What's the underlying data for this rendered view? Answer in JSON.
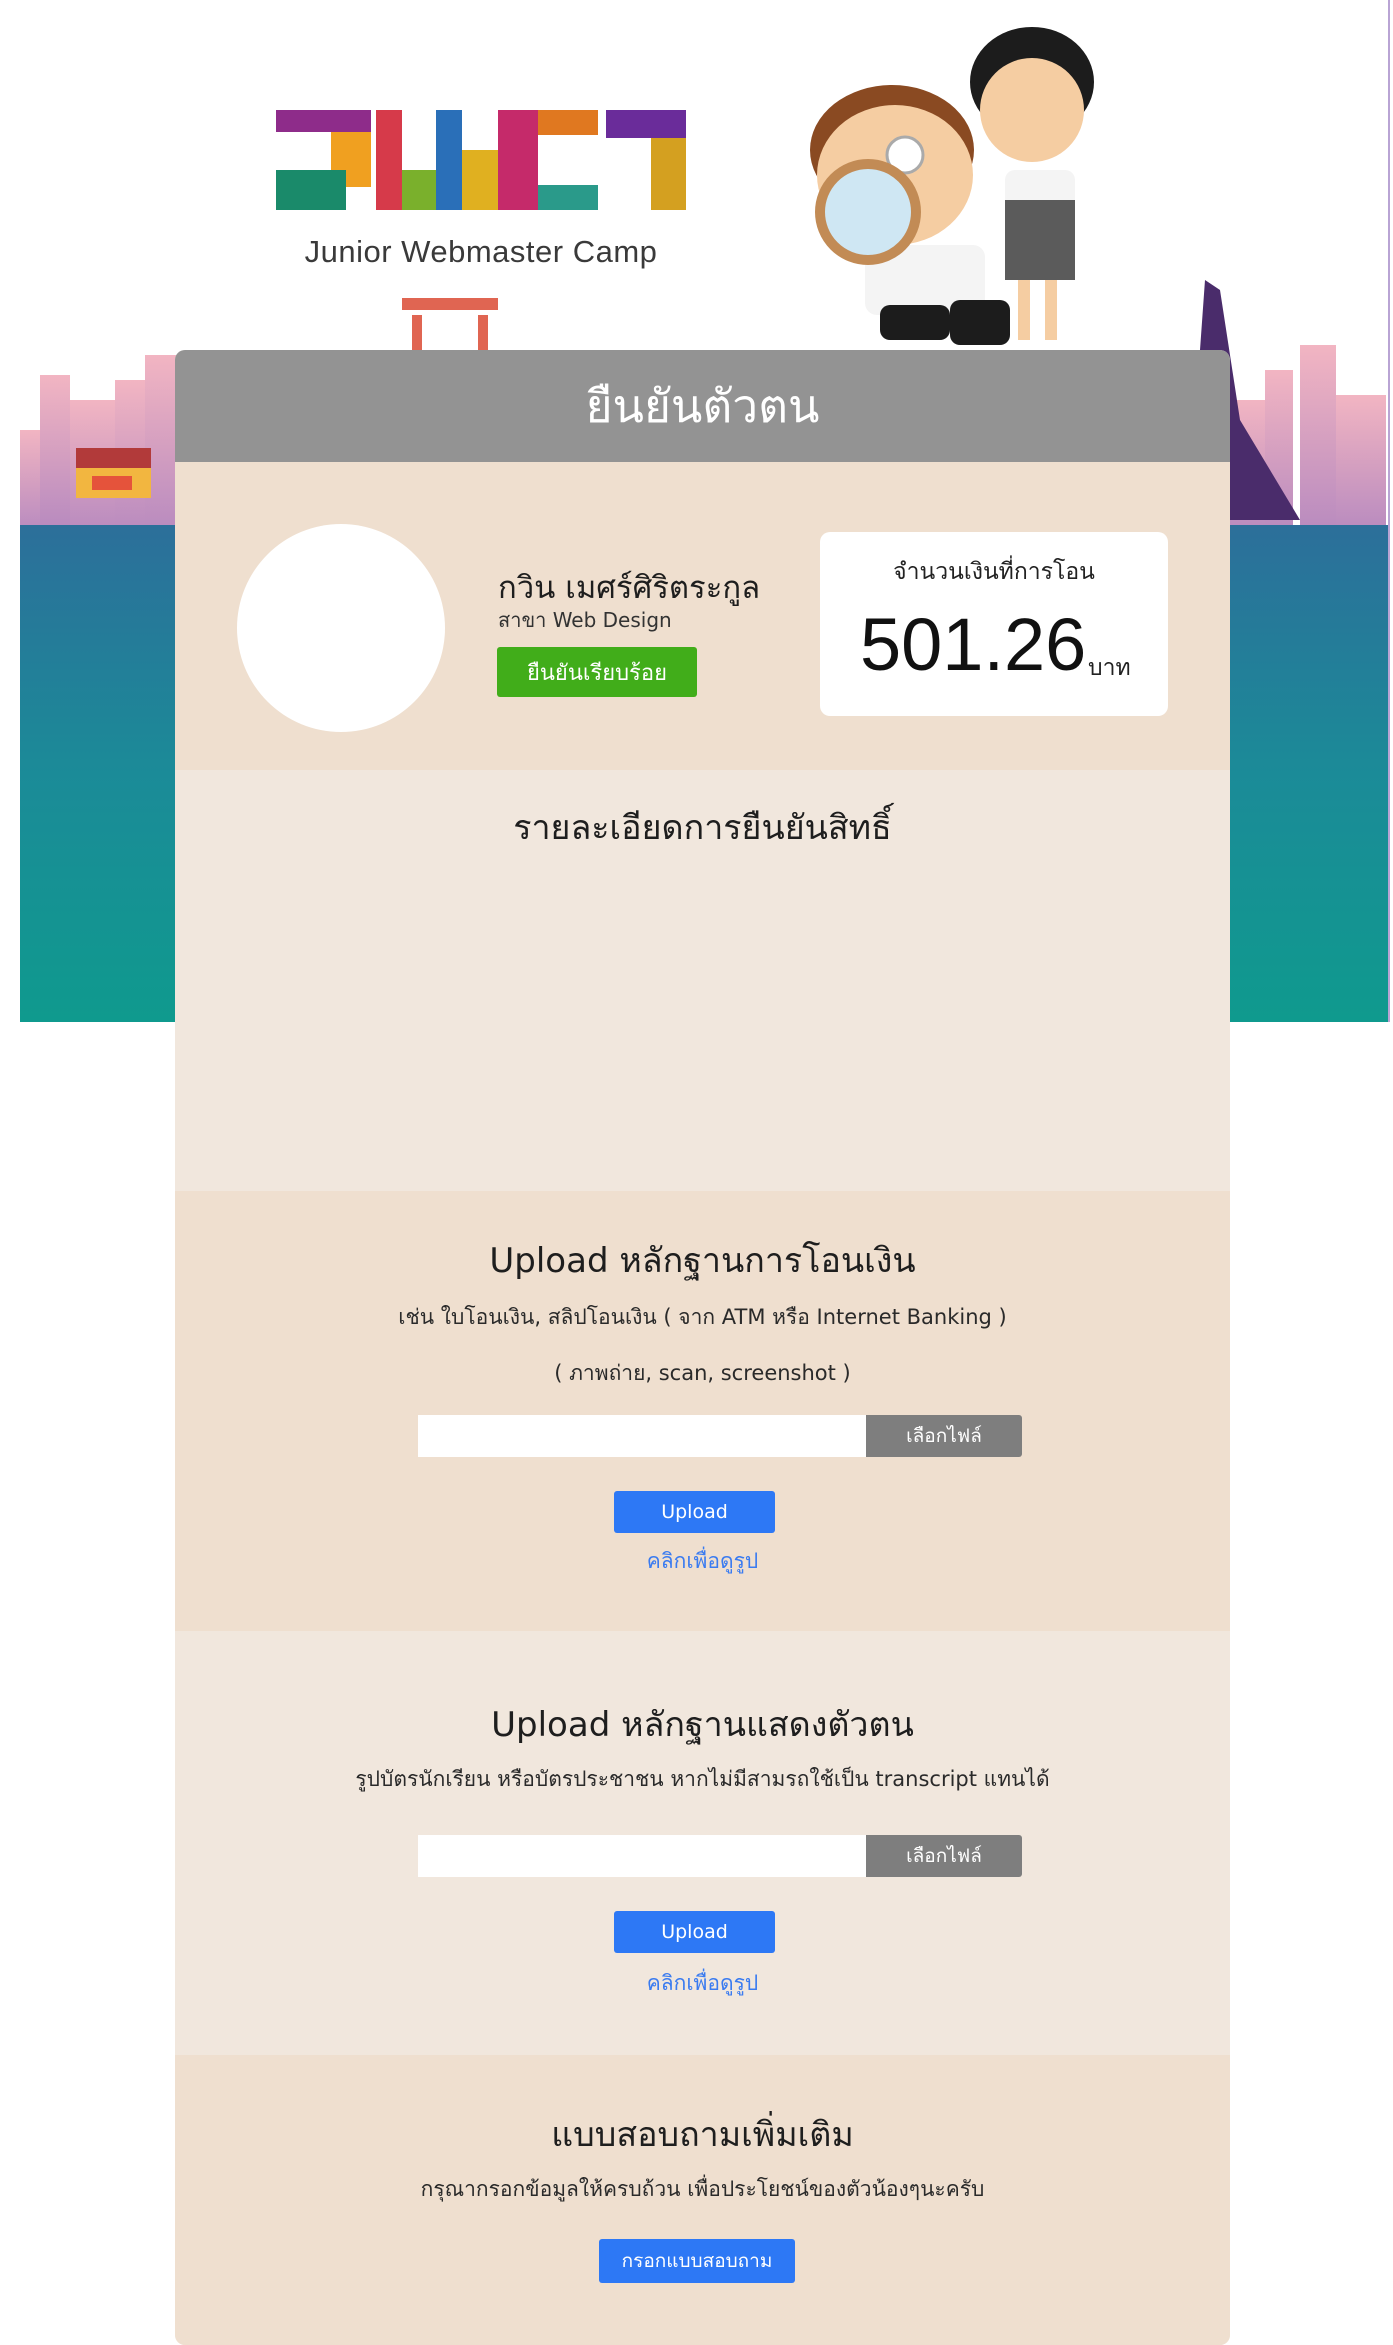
{
  "brand": {
    "logo_text": "JWC7",
    "subtitle": "Junior Webmaster Camp"
  },
  "card": {
    "title": "ยืนยันตัวตน"
  },
  "profile": {
    "name": "กวิน เมศร์ศิริตระกูล",
    "major": "สาขา Web Design",
    "status_button": "ยืนยันเรียบร้อย",
    "amount_label": "จำนวนเงินที่การโอน",
    "amount_value": "501.26",
    "amount_unit": "บาท"
  },
  "details": {
    "title": "รายละเอียดการยืนยันสิทธิ์"
  },
  "upload_payment": {
    "title": "Upload หลักฐานการโอนเงิน",
    "desc1": "เช่น ใบโอนเงิน, สลิปโอนเงิน ( จาก ATM หรือ Internet Banking )",
    "desc2": "( ภาพถ่าย, scan, screenshot )",
    "input_value": "",
    "choose_file": "เลือกไฟล์",
    "upload_button": "Upload",
    "view_link": "คลิกเพื่อดูรูป"
  },
  "upload_identity": {
    "title": "Upload หลักฐานแสดงตัวตน",
    "desc": "รูปบัตรนักเรียน หรือบัตรประชาชน หากไม่มีสามรถใช้เป็น transcript แทนได้",
    "input_value": "",
    "choose_file": "เลือกไฟล์",
    "upload_button": "Upload",
    "view_link": "คลิกเพื่อดูรูป"
  },
  "survey": {
    "title": "แบบสอบถามเพิ่มเติม",
    "desc": "กรุณากรอกข้อมูลให้ครบถ้วน เพื่อประโยชน์ของตัวน้องๆนะครับ",
    "button": "กรอกแบบสอบถาม"
  },
  "colors": {
    "header_gray": "#939393",
    "success_green": "#41ad1a",
    "primary_blue": "#2d78f5",
    "link_blue": "#3a7bf0",
    "card_beige": "#efdfcf"
  }
}
